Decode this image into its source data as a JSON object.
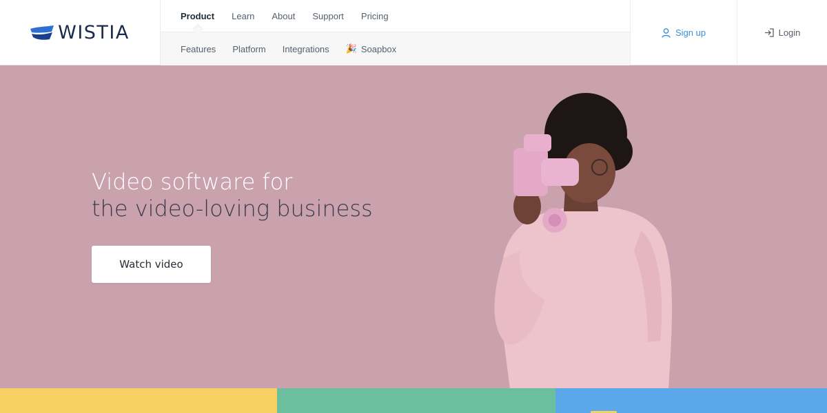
{
  "brand": {
    "name": "WISTIA"
  },
  "nav": {
    "primary": [
      {
        "label": "Product",
        "active": true
      },
      {
        "label": "Learn",
        "active": false
      },
      {
        "label": "About",
        "active": false
      },
      {
        "label": "Support",
        "active": false
      },
      {
        "label": "Pricing",
        "active": false
      }
    ],
    "secondary": [
      {
        "label": "Features"
      },
      {
        "label": "Platform"
      },
      {
        "label": "Integrations"
      },
      {
        "label": "Soapbox",
        "icon": "party-popper-icon"
      }
    ]
  },
  "account": {
    "signup_label": "Sign up",
    "login_label": "Login"
  },
  "hero": {
    "headline_line1": "Video software for",
    "headline_line2": "the video-loving business",
    "cta_label": "Watch video",
    "background_color": "#c9a2ae"
  },
  "colors": {
    "accent_blue": "#3b8fd6",
    "strip_yellow": "#f6d062",
    "strip_green": "#6bbf9f",
    "strip_blue": "#5aa8ea"
  }
}
